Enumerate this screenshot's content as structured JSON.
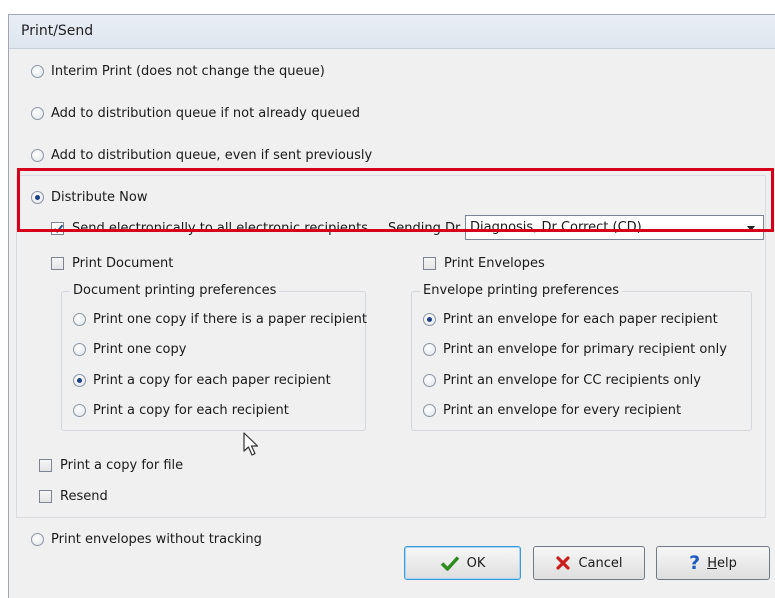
{
  "dialog": {
    "title": "Print/Send"
  },
  "options": {
    "interim": "Interim Print (does not change the queue)",
    "add_if_not_queued": "Add to distribution queue if not already queued",
    "add_even_if_sent": "Add to distribution queue, even if sent previously",
    "distribute_now": "Distribute Now",
    "print_envelopes_no_tracking": "Print envelopes without tracking",
    "selected": "distribute_now"
  },
  "distribute": {
    "send_electronic_label": "Send electronically to all electronic recipients",
    "send_electronic_checked": true,
    "sending_dr_label": "Sending Dr",
    "sending_dr_value": "Diagnosis, Dr Correct (CD)",
    "print_document_label": "Print Document",
    "print_document_checked": false,
    "print_envelopes_label": "Print Envelopes",
    "print_envelopes_checked": false,
    "print_copy_for_file_label": "Print a copy for file",
    "print_copy_for_file_checked": false,
    "resend_label": "Resend",
    "resend_checked": false
  },
  "document_prefs": {
    "title": "Document printing preferences",
    "items": [
      "Print one copy if there is a paper recipient",
      "Print one copy",
      "Print a copy for each paper recipient",
      "Print a copy for each recipient"
    ],
    "selected": "Print a copy for each paper recipient"
  },
  "envelope_prefs": {
    "title": "Envelope printing preferences",
    "items": [
      "Print an envelope for each paper recipient",
      "Print an envelope for primary recipient only",
      "Print an envelope for CC recipients only",
      "Print an envelope for every recipient"
    ],
    "selected": "Print an envelope for each paper recipient"
  },
  "buttons": {
    "ok": "OK",
    "cancel": "Cancel",
    "help_prefix": "",
    "help_underline": "H",
    "help_rest": "elp"
  },
  "colors": {
    "highlight": "#d7001b",
    "ok_check": "#2e8b1e",
    "cancel_x": "#cc1d1d",
    "help_q": "#1f5bbf"
  }
}
